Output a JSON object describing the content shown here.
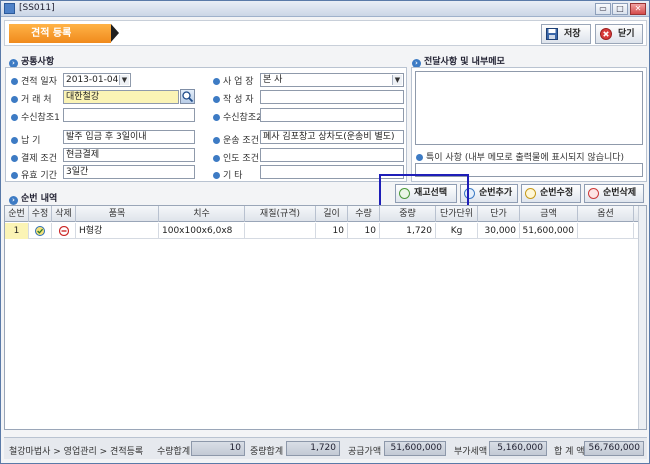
{
  "window": {
    "title": "[SS011]"
  },
  "header": {
    "tab_label": "견적 등록",
    "save_label": "저장",
    "close_label": "닫기"
  },
  "common": {
    "title": "공통사항",
    "estimate_date_label": "견적 일자",
    "estimate_date_value": "2013-01-04",
    "branch_label": "사 업 장",
    "branch_value": "본  사",
    "client_label": "거 래 처",
    "client_value": "대한철강",
    "writer_label": "작 성 자",
    "writer_value": "",
    "ref1_label": "수신참조1",
    "ref1_value": "",
    "ref2_label": "수신참조2",
    "ref2_value": "",
    "delivery_label": "납    기",
    "delivery_value": "발주 입금 후 3일이내",
    "transport_label": "운송 조건",
    "transport_value": "폐사 김포창고 상차도(운송비 별도)",
    "payment_label": "결제 조건",
    "payment_value": "현금결제",
    "handover_label": "인도 조건",
    "handover_value": "",
    "validity_label": "유효 기간",
    "validity_value": "3일간",
    "etc_label": "기    타",
    "etc_value": ""
  },
  "memo": {
    "title": "전달사항 및 내부메모",
    "special_label": "특이 사항 (내부 메모로 출력물에 표시되지 않습니다)",
    "special_value": ""
  },
  "detail": {
    "title": "순번 내역",
    "buttons": {
      "stock_select": "재고선택",
      "row_add": "순번추가",
      "row_edit": "순번수정",
      "row_delete": "순번삭제"
    },
    "columns": [
      "순번",
      "수정",
      "삭제",
      "품목",
      "치수",
      "재질(규격)",
      "길이",
      "수량",
      "중량",
      "단가단위",
      "단가",
      "금액",
      "옵션"
    ],
    "rows": [
      {
        "seq": "1",
        "item": "H형강",
        "size": "100x100x6,0x8",
        "material": "",
        "length": "10",
        "qty": "10",
        "weight": "1,720",
        "unit": "Kg",
        "price": "30,000",
        "amount": "51,600,000",
        "option": ""
      }
    ]
  },
  "status": {
    "breadcrumb": "철강마법사 > 영업관리 > 견적등록",
    "qty_total_label": "수량합계",
    "qty_total_value": "10",
    "weight_total_label": "중량합계",
    "weight_total_value": "1,720",
    "supply_label": "공급가액",
    "supply_value": "51,600,000",
    "vat_label": "부가세액",
    "vat_value": "5,160,000",
    "sum_label": "합 계 액",
    "sum_value": "56,760,000"
  },
  "colors": {
    "accent": "#f08a1c",
    "field_highlight": "#fbf4b5",
    "annotation_box": "#1e1eb8"
  }
}
